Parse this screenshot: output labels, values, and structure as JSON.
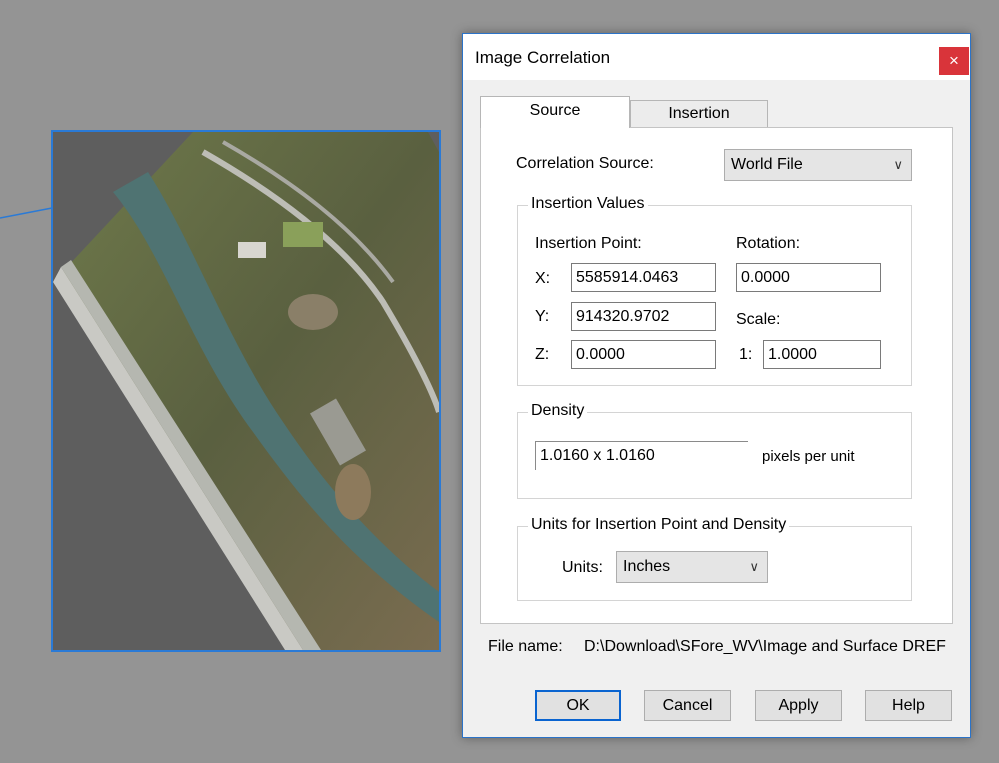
{
  "background_image": {
    "description_icon": "aerial-photo"
  },
  "dialog": {
    "title": "Image Correlation",
    "close_label": "×",
    "tabs": [
      {
        "label": "Source",
        "selected": true
      },
      {
        "label": "Insertion",
        "selected": false
      }
    ],
    "correlation_source": {
      "label": "Correlation Source:",
      "value": "World File"
    },
    "insertion_values": {
      "group_title": "Insertion Values",
      "insertion_point_label": "Insertion Point:",
      "rotation_label": "Rotation:",
      "scale_label": "Scale:",
      "x_label": "X:",
      "y_label": "Y:",
      "z_label": "Z:",
      "x_value": "5585914.0463",
      "y_value": "914320.9702",
      "z_value": "0.0000",
      "rotation_value": "0.0000",
      "scale_prefix": "1:",
      "scale_value": "1.0000"
    },
    "density": {
      "group_title": "Density",
      "value": "1.0160 x 1.0160",
      "unit_label": "pixels per unit"
    },
    "units": {
      "group_title": "Units for Insertion Point and Density",
      "label": "Units:",
      "value": "Inches"
    },
    "file_name": {
      "label": "File name:",
      "value": "D:\\Download\\SFore_WV\\Image and Surface DREF"
    },
    "buttons": {
      "ok": "OK",
      "cancel": "Cancel",
      "apply": "Apply",
      "help": "Help"
    }
  }
}
